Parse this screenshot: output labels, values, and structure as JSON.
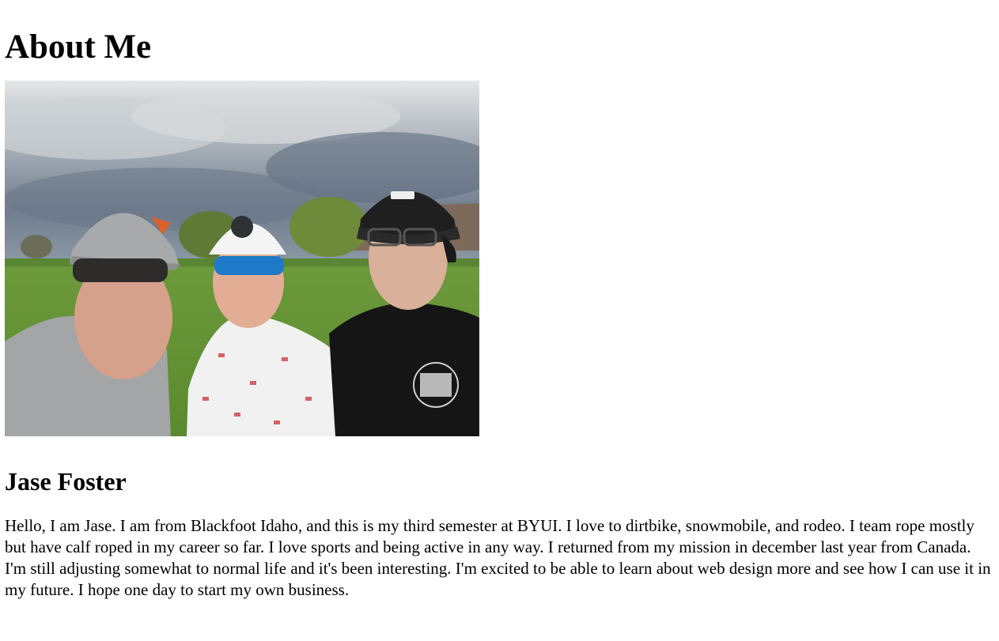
{
  "page": {
    "heading": "About Me",
    "name": "Jase Foster",
    "bio": "Hello, I am Jase. I am from Blackfoot Idaho, and this is my third semester at BYUI. I love to dirtbike, snowmobile, and rodeo. I team rope mostly but have calf roped in my career so far. I love sports and being active in any way. I returned from my mission in december last year from Canada. I'm still adjusting somewhat to normal life and it's been interesting. I'm excited to be able to learn about web design more and see how I can use it in my future. I hope one day to start my own business."
  },
  "photo": {
    "sky_color": "#9aa6b3",
    "grass_color": "#6f9a3f"
  }
}
